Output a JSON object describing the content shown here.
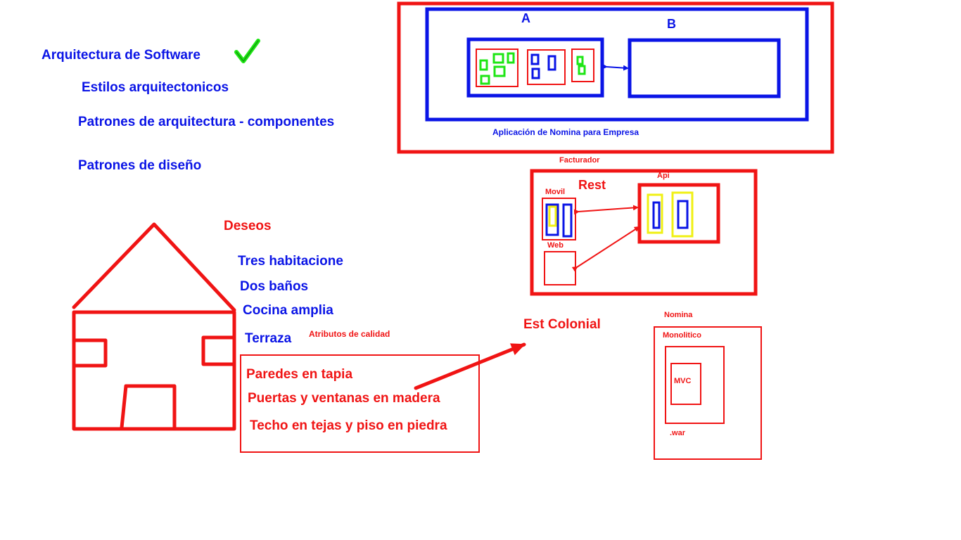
{
  "colors": {
    "red": "#f01414",
    "blue": "#0a14e6",
    "green": "#1ee614",
    "yellow": "#f0f014",
    "arrow_blue": "#0a14e6"
  },
  "icons": {
    "check": "check-mark-icon",
    "house": "house-drawing"
  },
  "topics": {
    "item1": "Arquitectura de Software",
    "item2": "Estilos arquitectonicos",
    "item3": "Patrones de arquitectura - componentes",
    "item4": "Patrones de diseño"
  },
  "app_diagram": {
    "label_a": "A",
    "label_b": "B",
    "caption": "Aplicación de Nomina para Empresa"
  },
  "house_section": {
    "heading": "Deseos",
    "wishes": [
      "Tres habitacione",
      "Dos baños",
      "Cocina amplia",
      "Terraza"
    ],
    "quality_label": "Atributos de calidad",
    "attributes": [
      "Paredes en tapia",
      "Puertas y ventanas en madera",
      "Techo en tejas y piso en piedra"
    ],
    "style": "Est Colonial"
  },
  "facturador": {
    "title": "Facturador",
    "rest": "Rest",
    "movil": "Movil",
    "web": "Web",
    "api": "Api"
  },
  "nomina": {
    "title": "Nomina",
    "monolitico": "Monolitico",
    "mvc": "MVC",
    "war": ".war"
  }
}
